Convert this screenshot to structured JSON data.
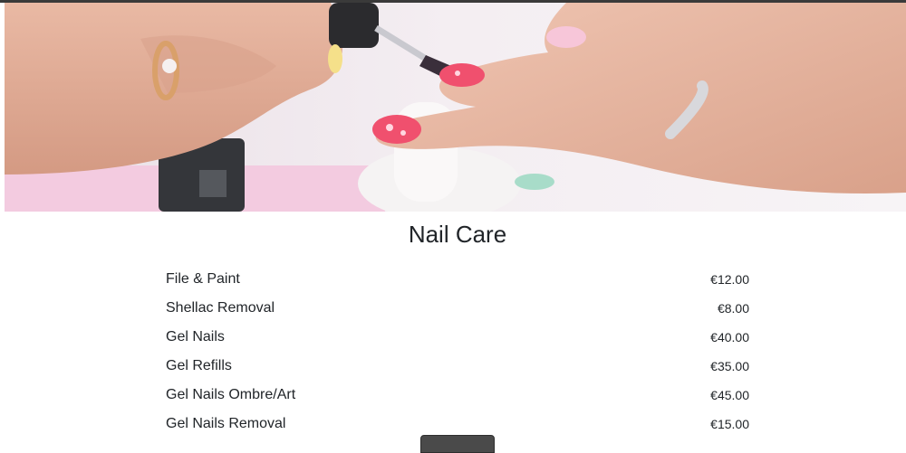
{
  "section": {
    "title": "Nail Care"
  },
  "services": [
    {
      "name": "File & Paint",
      "price": "€12.00"
    },
    {
      "name": "Shellac Removal",
      "price": "€8.00"
    },
    {
      "name": "Gel Nails",
      "price": "€40.00"
    },
    {
      "name": "Gel Refills",
      "price": "€35.00"
    },
    {
      "name": "Gel Nails Ombre/Art",
      "price": "€45.00"
    },
    {
      "name": "Gel Nails Removal",
      "price": "€15.00"
    }
  ],
  "colors": {
    "text": "#212529",
    "top_strip": "#3a3a3a",
    "button": "#4a4a4a",
    "nail_polish": "#f0506e"
  },
  "hero_image": {
    "subject": "manicure-photo"
  }
}
